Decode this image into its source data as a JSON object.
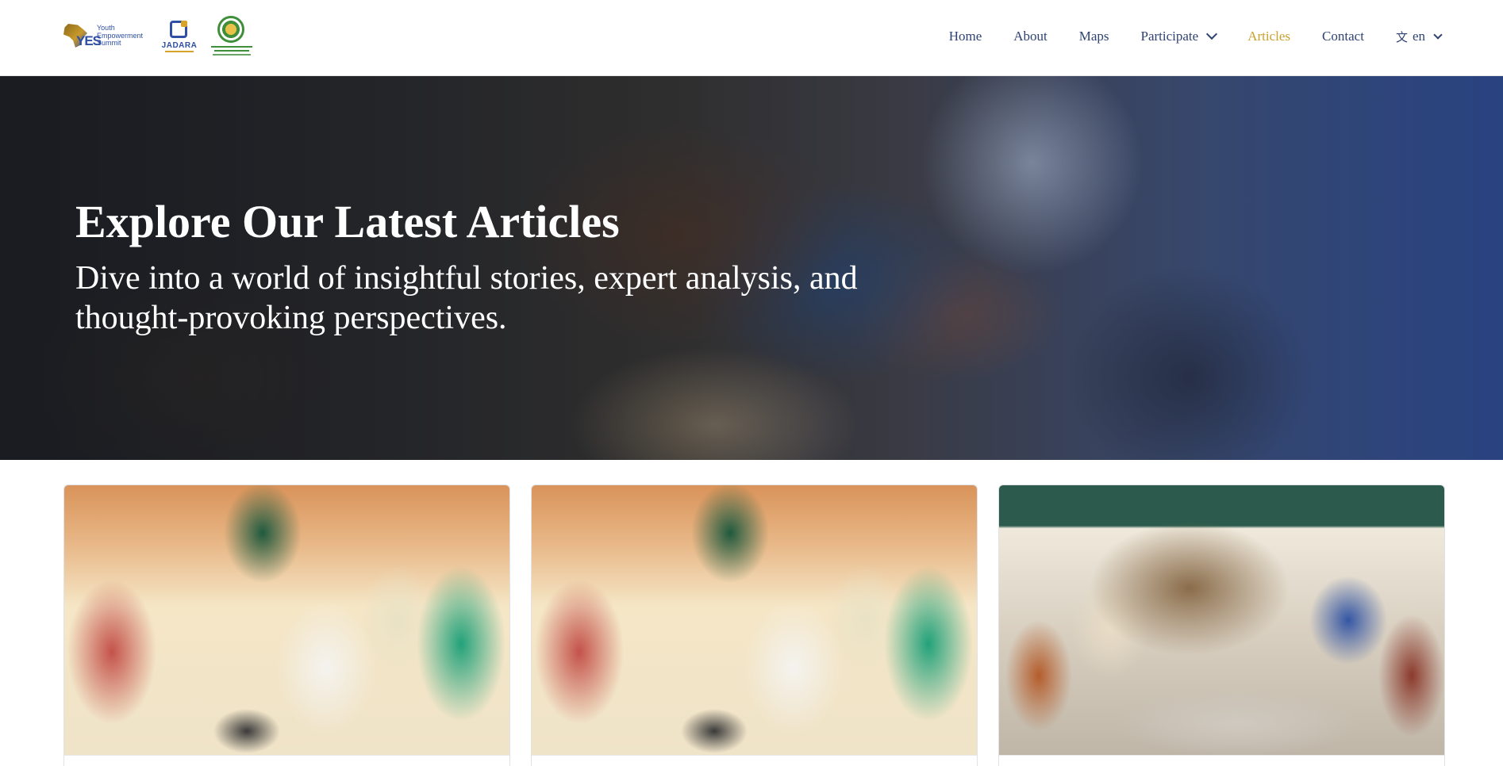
{
  "brand": {
    "logos": [
      {
        "name": "Youth Empowerment Summit",
        "text_lines": [
          "Youth",
          "Empowerment",
          "Summit"
        ],
        "mark": "YES"
      },
      {
        "name": "JADARA",
        "text": "JADARA"
      },
      {
        "name": "African Union seal"
      }
    ]
  },
  "nav": {
    "home": "Home",
    "about": "About",
    "maps": "Maps",
    "participate": "Participate",
    "articles": "Articles",
    "contact": "Contact",
    "language": "en",
    "active": "Articles"
  },
  "colors": {
    "nav_text": "#2f4373",
    "nav_active": "#c9a02c",
    "hero_text": "#ffffff"
  },
  "icons": {
    "language": "translate-icon",
    "dropdown": "chevron-down-icon"
  },
  "hero": {
    "title": "Explore Our Latest Articles",
    "subtitle": "Dive into a world of insightful stories, expert analysis, and thought-provoking perspectives."
  },
  "articles": [
    {
      "image": "group discussion with young people seated in a circle"
    },
    {
      "image": "group discussion with young people seated in a circle"
    },
    {
      "image": "students writing at a table in a library"
    }
  ]
}
